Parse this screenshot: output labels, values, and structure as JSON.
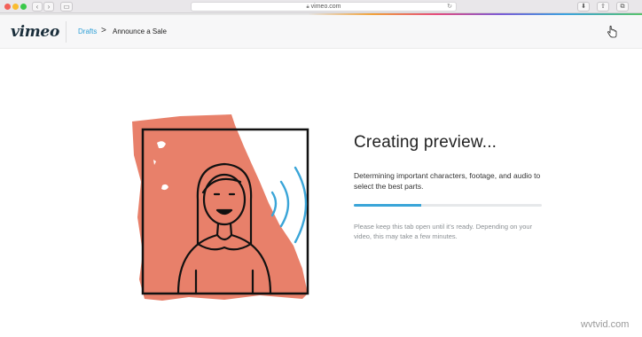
{
  "browser": {
    "url": "vimeo.com"
  },
  "header": {
    "logo_text": "vimeo",
    "breadcrumb": {
      "drafts": "Drafts",
      "separator": ">",
      "current": "Announce a Sale"
    }
  },
  "main": {
    "title": "Creating preview...",
    "description": "Determining important characters, footage, and audio to select the best parts.",
    "progress_fraction": 0.36,
    "note": "Please keep this tab open until it’s ready. Depending on your video, this may take a few minutes."
  },
  "watermark": "wvtvid.com",
  "colors": {
    "accent": "#3aa5d8",
    "illustration_orange": "#e8806a",
    "link": "#2e9fd6"
  }
}
